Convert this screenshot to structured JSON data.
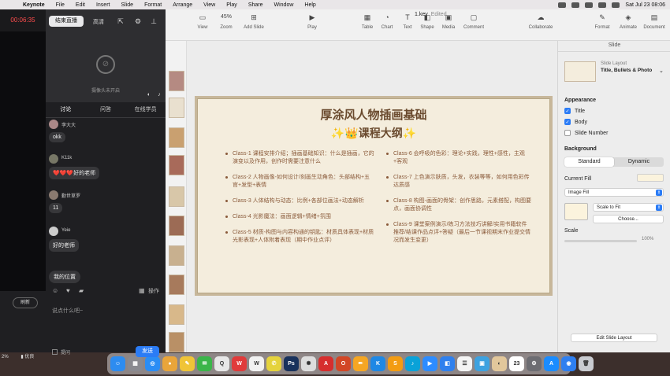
{
  "menubar": {
    "app": "Keynote",
    "items": [
      "File",
      "Edit",
      "Insert",
      "Slide",
      "Format",
      "Arrange",
      "View",
      "Play",
      "Share",
      "Window",
      "Help"
    ],
    "clock": "Sat Jul 23 08:06"
  },
  "document": {
    "title": "1.key",
    "status": "Edited"
  },
  "toolbar": {
    "view": "View",
    "zoom_value": "45%",
    "zoom": "Zoom",
    "add_slide": "Add Slide",
    "play": "Play",
    "table": "Table",
    "chart": "Chart",
    "text": "Text",
    "shape": "Shape",
    "media": "Media",
    "comment": "Comment",
    "collaborate": "Collaborate",
    "format": "Format",
    "animate": "Animate",
    "document": "Document"
  },
  "slide": {
    "title": "厚涂风人物插画基础",
    "subtitle": "✨👑课程大纲✨",
    "left_items": [
      "Class-1 课程安排介绍；插画基础知识：什么是插画，它的演变以及作用，创作时需要注意什么",
      "Class-2 人物画像-如何设计/刻画生动角色：头部结构+五官+发型+表情",
      "Class-3 人体结构与动态：比例+各部位画法+动态解析",
      "Class-4 光影魔法：画面逻辑+情绪+氛围",
      "Class-5 材质-构图与内容构通的钥匙：材质具体表现+材质光影表现+人体附着表现（期中作业点评）"
    ],
    "right_items": [
      "Class-6 会呼吸的色彩：理论+实践，理性+感性，主观+客观",
      "Class-7 上色演示肤质，头发，衣装等等，如何用色彩传达质感",
      "Class-8 构图-画面的骨架：创作思路，元素搭配，构图要点，画面协调性",
      "Class-9 课堂案例演示/练习方法技巧讲解/实用书籍软件推荐/结课作品点评+答疑（最后一节课视期末作业提交情况而发生变更）"
    ]
  },
  "inspector": {
    "header": "Slide",
    "layout_label": "Slide Layout",
    "layout_name": "Title, Bullets & Photo",
    "appearance": "Appearance",
    "title_check": "Title",
    "body_check": "Body",
    "slide_number_check": "Slide Number",
    "background": "Background",
    "seg_standard": "Standard",
    "seg_dynamic": "Dynamic",
    "current_fill": "Current Fill",
    "fill_type": "Image Fill",
    "scale_mode": "Scale to Fit",
    "choose": "Choose...",
    "scale": "Scale",
    "scale_value": "100%",
    "edit_layout": "Edit Slide Layout"
  },
  "stream": {
    "timer": "00:06:35",
    "end_live": "结束直播",
    "quality": "高清",
    "camera_off": "摄像头未开启",
    "tabs": [
      "讨论",
      "问答",
      "在线学员"
    ],
    "messages": [
      {
        "user": "李大大",
        "text": "okk"
      },
      {
        "user": "K11k",
        "text": "❤️❤️❤️好的老师"
      },
      {
        "user": "勤世草罗",
        "text": "11"
      },
      {
        "user": "Yeie",
        "text": "好的老师"
      }
    ],
    "my_location": "我的位置",
    "ops": "操作",
    "input_placeholder": "说点什么吧~",
    "raise_hand": "提问",
    "send": "发送",
    "refresh": "刷新",
    "network_pct": "2%",
    "network_label": "优良"
  },
  "dock": {
    "apps": [
      {
        "name": "finder",
        "glyph": "☺",
        "color": "#2d8cf0"
      },
      {
        "name": "launchpad",
        "glyph": "▦",
        "color": "#8a8a90"
      },
      {
        "name": "safari",
        "glyph": "◎",
        "color": "#2a8df5"
      },
      {
        "name": "chrome",
        "glyph": "●",
        "color": "#e9a53a"
      },
      {
        "name": "notes",
        "glyph": "✎",
        "color": "#f0c437"
      },
      {
        "name": "wechat",
        "glyph": "✉",
        "color": "#3bb54a"
      },
      {
        "name": "qq",
        "glyph": "Q",
        "color": "#e7e7e7"
      },
      {
        "name": "weibo",
        "glyph": "W",
        "color": "#e03b3b"
      },
      {
        "name": "wechat-work",
        "glyph": "W",
        "color": "#f1f1f1"
      },
      {
        "name": "messages",
        "glyph": "✆",
        "color": "#e5d33d"
      },
      {
        "name": "photoshop",
        "glyph": "Ps",
        "color": "#19325c"
      },
      {
        "name": "chatgpt",
        "glyph": "✺",
        "color": "#dddddd"
      },
      {
        "name": "acrobat",
        "glyph": "A",
        "color": "#d62e2e"
      },
      {
        "name": "office",
        "glyph": "O",
        "color": "#d24726"
      },
      {
        "name": "pencil",
        "glyph": "✏",
        "color": "#f5a623"
      },
      {
        "name": "keynote",
        "glyph": "K",
        "color": "#1e88e5"
      },
      {
        "name": "sketchbook",
        "glyph": "S",
        "color": "#f39c12"
      },
      {
        "name": "qq-music",
        "glyph": "♪",
        "color": "#0aa2d8"
      },
      {
        "name": "zoom",
        "glyph": "▶",
        "color": "#2d8cff"
      },
      {
        "name": "facetime",
        "glyph": "◧",
        "color": "#2f80ed"
      },
      {
        "name": "reminders",
        "glyph": "☰",
        "color": "#f4f4f4"
      },
      {
        "name": "preview",
        "glyph": "▣",
        "color": "#3da2e0"
      },
      {
        "name": "contacts",
        "glyph": "◐",
        "color": "#e2c79b"
      },
      {
        "name": "calendar",
        "glyph": "23",
        "color": "#ffffff"
      },
      {
        "name": "system-settings",
        "glyph": "⚙",
        "color": "#6d6d72"
      },
      {
        "name": "app-store",
        "glyph": "A",
        "color": "#1a8cff"
      },
      {
        "name": "qq-browser",
        "glyph": "◉",
        "color": "#2f7ff0"
      },
      {
        "name": "trash",
        "glyph": "🗑",
        "color": "#c9cbd0"
      }
    ]
  }
}
